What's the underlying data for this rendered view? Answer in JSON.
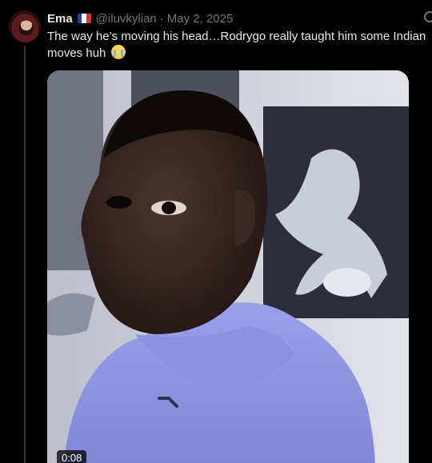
{
  "author": {
    "name": "Ema",
    "flag": "France",
    "handle": "@iluvkylian",
    "separator": "·",
    "date": "May 2, 2025"
  },
  "post": {
    "text": "The way he’s moving his head…Rodrygo really taught him some Indian moves huh",
    "emoji": "loudly-crying-face"
  },
  "media": {
    "type": "video",
    "duration": "0:08"
  },
  "icons": {
    "avatar": "avatar",
    "more": "more-icon"
  },
  "colors": {
    "background": "#000000",
    "text": "#e7e9ea",
    "muted": "#71767b",
    "hoodie": "#8f96e0"
  }
}
